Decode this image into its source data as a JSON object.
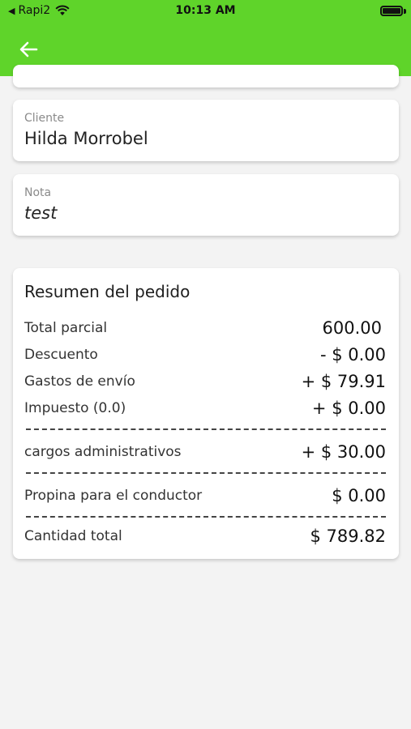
{
  "status_bar": {
    "carrier": "Rapi2",
    "time": "10:13 AM"
  },
  "colors": {
    "header_bg": "#5fd42a",
    "page_bg": "#f3f3f3"
  },
  "header": {
    "back_icon": "arrow-left-icon"
  },
  "client": {
    "label": "Cliente",
    "value": "Hilda Morrobel"
  },
  "note": {
    "label": "Nota",
    "value": "test"
  },
  "summary": {
    "title": "Resumen del pedido",
    "rows": [
      {
        "label": "Total parcial",
        "amount": "600.00"
      },
      {
        "label": "Descuento",
        "amount": "- $ 0.00"
      },
      {
        "label": "Gastos de envío",
        "amount": "+ $ 79.91"
      },
      {
        "label": "Impuesto (0.0)",
        "amount": "+ $ 0.00"
      },
      {
        "label": "cargos administrativos",
        "amount": "+ $ 30.00"
      },
      {
        "label": "Propina para el conductor",
        "amount": "$ 0.00"
      },
      {
        "label": "Cantidad total",
        "amount": "$ 789.82"
      }
    ]
  }
}
